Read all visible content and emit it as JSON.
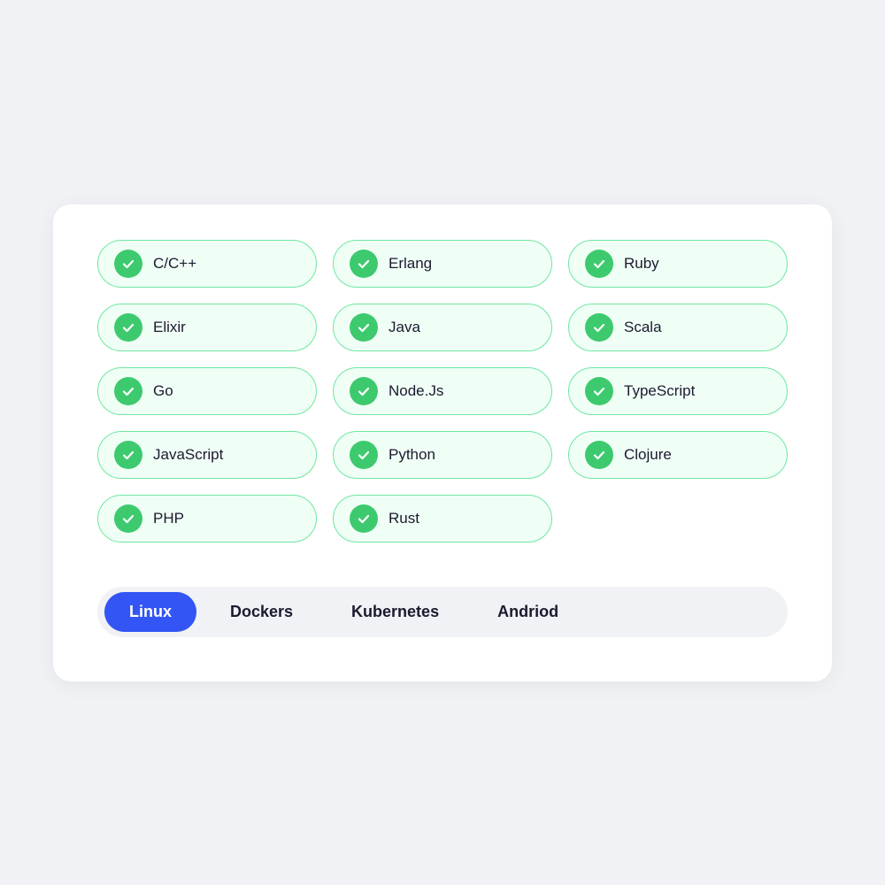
{
  "chips": [
    {
      "label": "C/C++"
    },
    {
      "label": "Erlang"
    },
    {
      "label": "Ruby"
    },
    {
      "label": "Elixir"
    },
    {
      "label": "Java"
    },
    {
      "label": "Scala"
    },
    {
      "label": "Go"
    },
    {
      "label": "Node.Js"
    },
    {
      "label": "TypeScript"
    },
    {
      "label": "JavaScript"
    },
    {
      "label": "Python"
    },
    {
      "label": "Clojure"
    },
    {
      "label": "PHP"
    },
    {
      "label": "Rust"
    }
  ],
  "tabs": [
    {
      "label": "Linux",
      "active": true
    },
    {
      "label": "Dockers",
      "active": false
    },
    {
      "label": "Kubernetes",
      "active": false
    },
    {
      "label": "Andriod",
      "active": false
    }
  ]
}
